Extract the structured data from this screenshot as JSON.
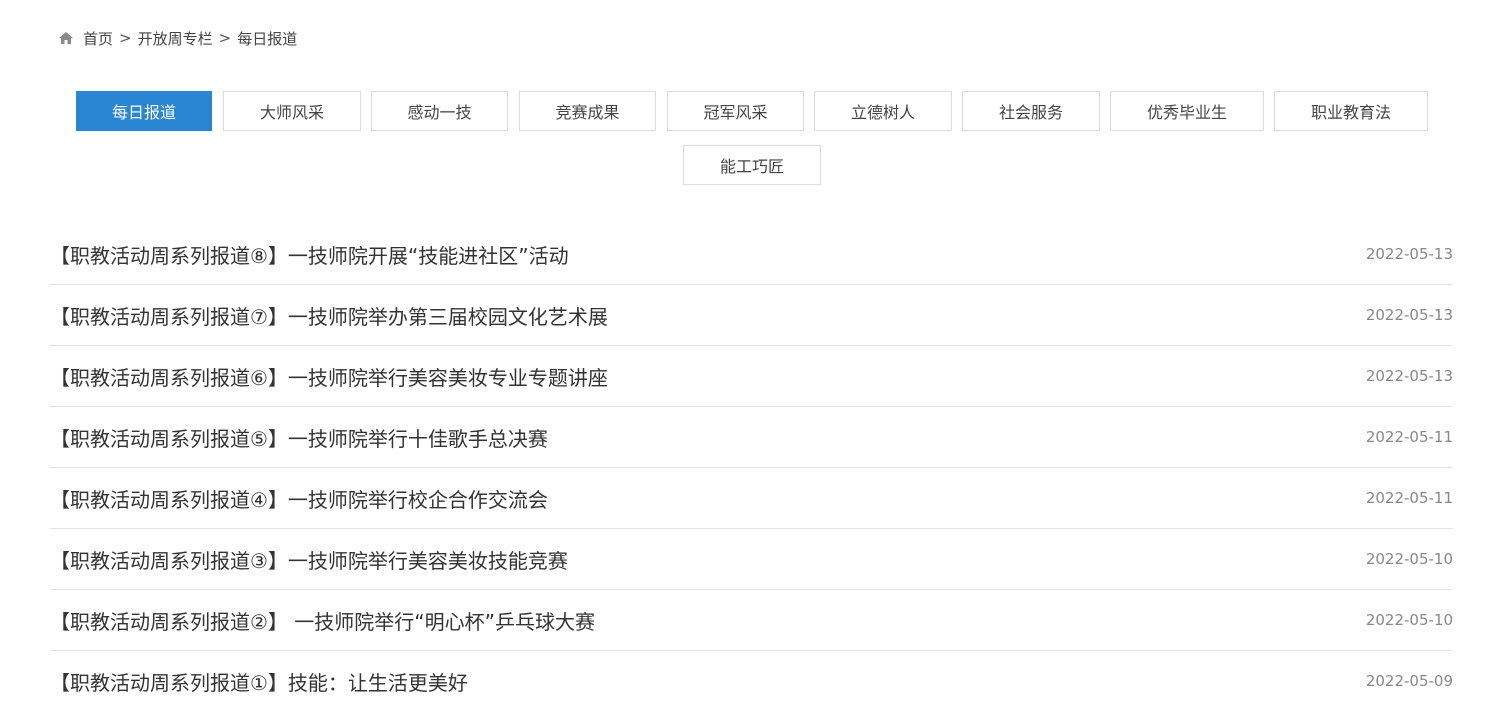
{
  "breadcrumb": {
    "icon": "home-icon",
    "items": [
      "首页",
      "开放周专栏",
      "每日报道"
    ],
    "separator": ">"
  },
  "tabs": [
    {
      "label": "每日报道",
      "active": true
    },
    {
      "label": "大师风采",
      "active": false
    },
    {
      "label": "感动一技",
      "active": false
    },
    {
      "label": "竞赛成果",
      "active": false
    },
    {
      "label": "冠军风采",
      "active": false
    },
    {
      "label": "立德树人",
      "active": false
    },
    {
      "label": "社会服务",
      "active": false
    },
    {
      "label": "优秀毕业生",
      "active": false
    },
    {
      "label": "职业教育法",
      "active": false
    },
    {
      "label": "能工巧匠",
      "active": false
    }
  ],
  "news": [
    {
      "title": "【职教活动周系列报道⑧】一技师院开展“技能进社区”活动",
      "date": "2022-05-13"
    },
    {
      "title": "【职教活动周系列报道⑦】一技师院举办第三届校园文化艺术展",
      "date": "2022-05-13"
    },
    {
      "title": "【职教活动周系列报道⑥】一技师院举行美容美妆专业专题讲座",
      "date": "2022-05-13"
    },
    {
      "title": "【职教活动周系列报道⑤】一技师院举行十佳歌手总决赛",
      "date": "2022-05-11"
    },
    {
      "title": "【职教活动周系列报道④】一技师院举行校企合作交流会",
      "date": "2022-05-11"
    },
    {
      "title": "【职教活动周系列报道③】一技师院举行美容美妆技能竞赛",
      "date": "2022-05-10"
    },
    {
      "title": "【职教活动周系列报道②】 一技师院举行“明心杯”乒乓球大赛",
      "date": "2022-05-10"
    },
    {
      "title": "【职教活动周系列报道①】技能：让生活更美好",
      "date": "2022-05-09"
    }
  ],
  "colors": {
    "accent": "#2a86d3",
    "border": "#dcdcdc",
    "text": "#333333",
    "date": "#888888"
  }
}
